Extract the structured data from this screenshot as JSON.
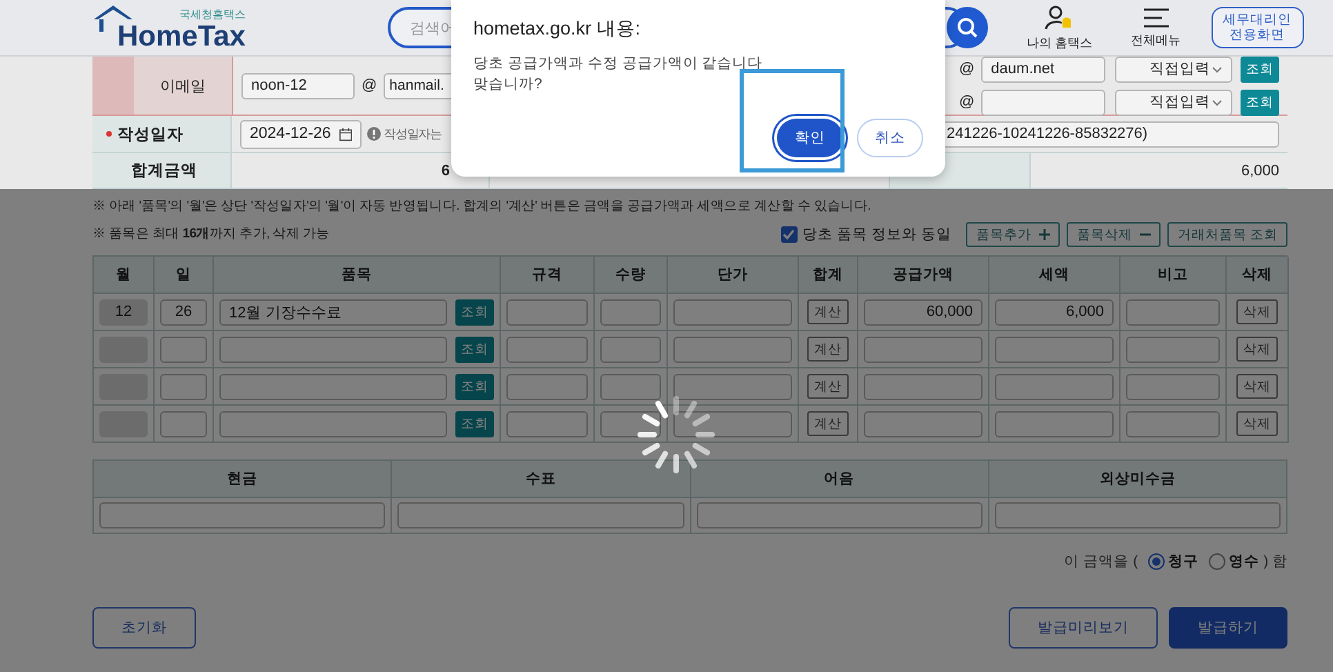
{
  "header": {
    "logo_subtitle": "국세청홈택스",
    "logo": "HomeTax",
    "search_placeholder": "검색어",
    "menu": [
      {
        "label": "나의 홈택스"
      },
      {
        "label": "전체메뉴"
      }
    ],
    "agent_button": "세무대리인 전용화면"
  },
  "email": {
    "label": "이메일",
    "supplier": {
      "id": "noon-12",
      "at": "@",
      "domain": "hanmail."
    },
    "buyer": [
      {
        "at": "@",
        "domain": "daum.net",
        "select": "직접입력",
        "button": "조회"
      },
      {
        "at": "@",
        "select": "직접입력",
        "button": "조회"
      }
    ]
  },
  "date": {
    "label": "작성일자",
    "required": true,
    "value": "2024-12-26",
    "note": "작성일자는",
    "approval_no": "241226-10241226-85832276)"
  },
  "sum": {
    "label": "합계금액",
    "supply_total": "6",
    "tax_total": "6,000"
  },
  "notes": [
    "※ 아래 '품목'의 '월'은 상단 '작성일자'의 '월'이 자동 반영됩니다. 합계의 '계산' 버튼은 금액을 공급가액과 세액으로 계산할 수 있습니다.",
    "※ 품목은 최대 **16개**까지 추가, 삭제 가능"
  ],
  "item_options": {
    "same_as_original": {
      "label": "당초 품목 정보와 동일",
      "checked": true
    },
    "buttons": [
      {
        "label": "품목추가"
      },
      {
        "label": "품목삭제"
      },
      {
        "label": "거래처품목 조회"
      }
    ]
  },
  "items": {
    "columns": [
      "월",
      "일",
      "품목",
      "규격",
      "수량",
      "단가",
      "합계",
      "공급가액",
      "세액",
      "비고",
      "삭제"
    ],
    "rows": [
      {
        "month": "12",
        "day": "26",
        "item": "12월 기장수수료",
        "lookup": "조회",
        "calc": "계산",
        "supply": "60,000",
        "tax": "6,000",
        "delete": "삭제"
      },
      {
        "lookup": "조회",
        "calc": "계산",
        "delete": "삭제"
      },
      {
        "lookup": "조회",
        "calc": "계산",
        "delete": "삭제"
      },
      {
        "lookup": "조회",
        "calc": "계산",
        "delete": "삭제"
      }
    ]
  },
  "payment": {
    "columns": [
      "현금",
      "수표",
      "어음",
      "외상미수금"
    ]
  },
  "receipt": {
    "prefix": "이 금액을 (",
    "options": [
      {
        "label": "청구",
        "selected": true
      },
      {
        "label": "영수",
        "selected": false
      }
    ],
    "suffix": ") 함"
  },
  "actions": [
    {
      "label": "초기화",
      "kind": "outline"
    },
    {
      "label": "발급미리보기",
      "kind": "outline"
    },
    {
      "label": "발급하기",
      "kind": "primary"
    }
  ],
  "loading": true,
  "dialog": {
    "title": "hometax.go.kr 내용:",
    "message": [
      "당초 공급가액과 수정 공급가액이 같습니다",
      "맞습니까?"
    ],
    "buttons": [
      {
        "label": "확인",
        "kind": "primary"
      },
      {
        "label": "취소",
        "kind": "secondary"
      }
    ],
    "highlight": true
  }
}
